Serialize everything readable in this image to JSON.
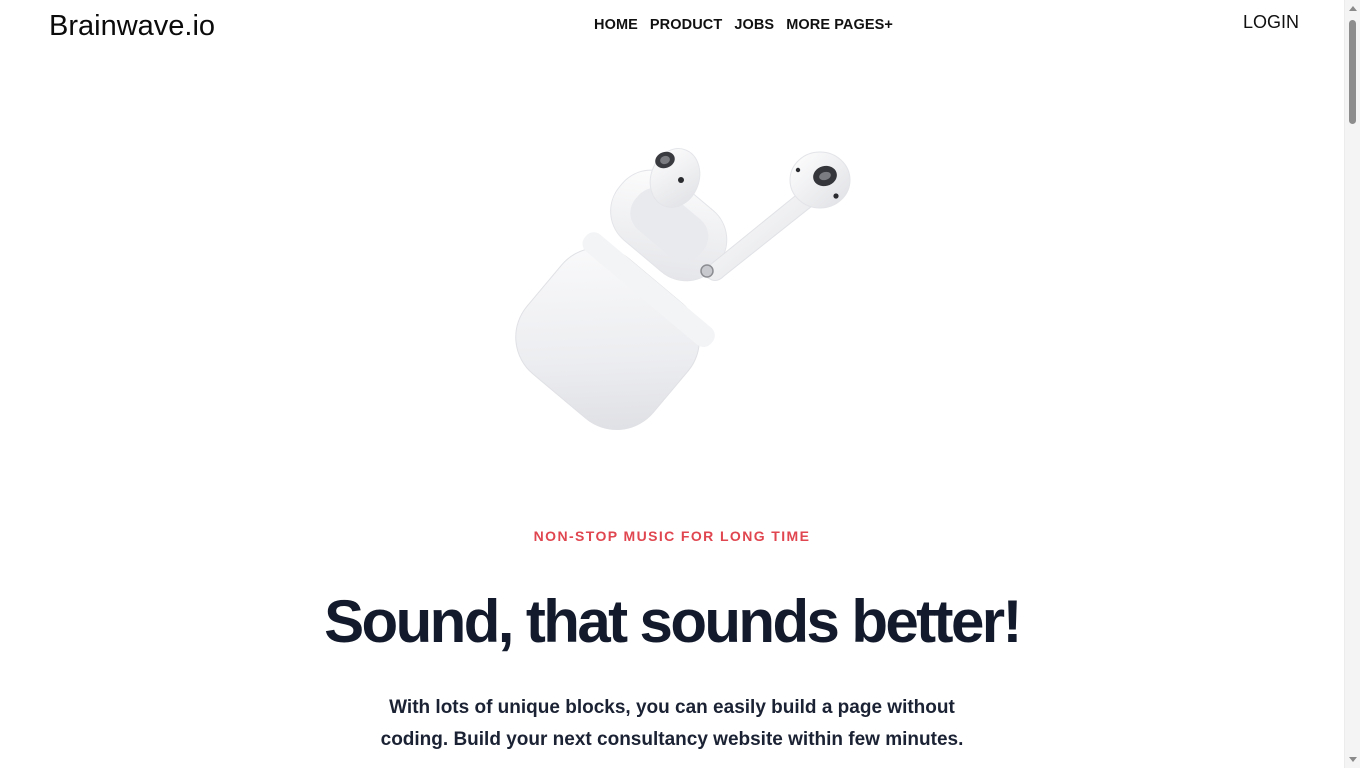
{
  "header": {
    "brand": "Brainwave.io",
    "nav": [
      {
        "label": "HOME"
      },
      {
        "label": "PRODUCT"
      },
      {
        "label": "JOBS"
      },
      {
        "label": "MORE PAGES+"
      }
    ],
    "login_label": "LOGIN"
  },
  "hero": {
    "image_icon": "airpods-image",
    "kicker": "NON-STOP MUSIC FOR LONG TIME",
    "headline": "Sound, that sounds better!",
    "subtext": "With lots of unique blocks, you can easily build a page without coding. Build your next consultancy website within few minutes."
  },
  "colors": {
    "accent": "#e0464f",
    "headline": "#131a2b",
    "background": "#ffffff"
  }
}
